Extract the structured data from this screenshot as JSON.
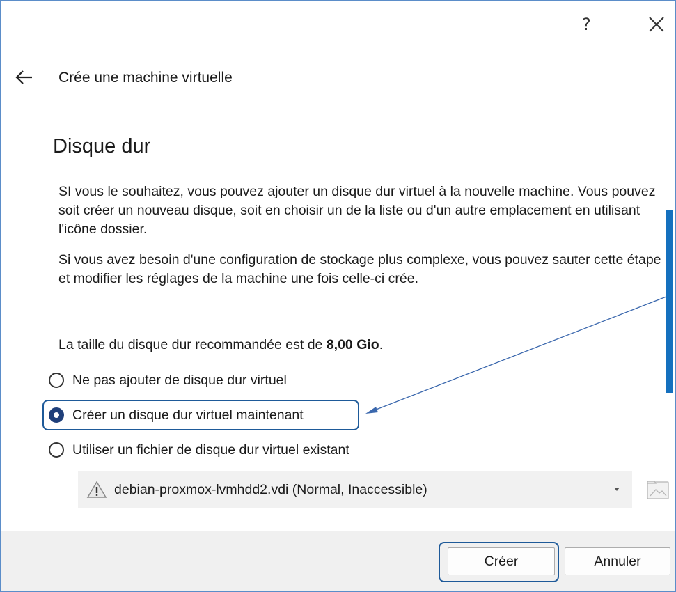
{
  "window": {
    "help_label": "?",
    "title": "Crée une machine virtuelle"
  },
  "page": {
    "title": "Disque dur",
    "paragraph1": "SI vous le souhaitez, vous pouvez ajouter un disque dur virtuel à la nouvelle machine. Vous pouvez soit créer un nouveau disque, soit en choisir un de la liste ou d'un autre emplacement en utilisant l'icône dossier.",
    "paragraph2": "Si vous avez besoin d'une configuration de stockage plus complexe, vous pouvez sauter cette étape et modifier les réglages de la machine une fois celle-ci crée.",
    "recommend_prefix": "La taille du disque dur recommandée est de ",
    "recommend_size": "8,00 Gio",
    "recommend_suffix": "."
  },
  "options": [
    {
      "label": "Ne pas ajouter de disque dur virtuel",
      "checked": false
    },
    {
      "label": "Créer un disque dur virtuel maintenant",
      "checked": true
    },
    {
      "label": "Utiliser un fichier de disque dur virtuel existant",
      "checked": false
    }
  ],
  "disk_select": {
    "value": "debian-proxmox-lvmhdd2.vdi (Normal, Inaccessible)"
  },
  "buttons": {
    "create": "Créer",
    "cancel": "Annuler"
  },
  "colors": {
    "accent": "#1e5a99",
    "annotation_bar": "#1570be"
  }
}
